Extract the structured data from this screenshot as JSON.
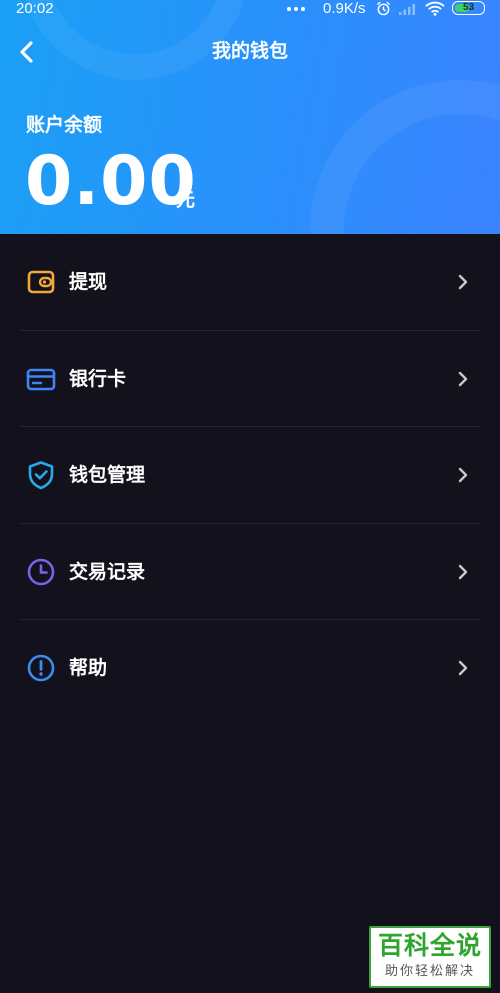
{
  "status_bar": {
    "time": "20:02",
    "speed": "0.9K/s",
    "battery": "53",
    "icons": [
      "more-dots-icon",
      "alarm-icon",
      "signal-icon",
      "wifi-icon",
      "battery-icon"
    ]
  },
  "nav": {
    "title": "我的钱包",
    "back_icon": "back-arrow-icon"
  },
  "balance": {
    "label": "账户余额",
    "amount": "0.00",
    "unit": "元"
  },
  "menu": {
    "items": [
      {
        "label": "提现",
        "icon": "wallet-icon",
        "color": "#f2a93b"
      },
      {
        "label": "银行卡",
        "icon": "bank-card-icon",
        "color": "#3d86f5"
      },
      {
        "label": "钱包管理",
        "icon": "shield-icon",
        "color": "#2aa9e8"
      },
      {
        "label": "交易记录",
        "icon": "clock-icon",
        "color": "#7a63e8"
      },
      {
        "label": "帮助",
        "icon": "info-icon",
        "color": "#3a8cf0"
      }
    ]
  },
  "colors": {
    "header_start": "#1aa0f5",
    "header_end": "#3b83ff",
    "background": "#13121c",
    "divider": "#24232e",
    "chevron": "#c8c8cc"
  },
  "watermark": {
    "main": "百科全说",
    "sub": "助你轻松解决"
  }
}
